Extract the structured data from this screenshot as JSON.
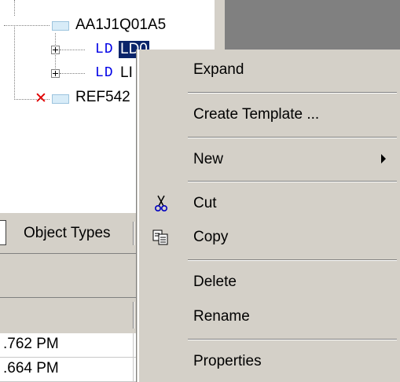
{
  "tree": {
    "root_label": "AA1J1Q01A5",
    "ld_tag": "LD",
    "ld1_name": "LD0",
    "ld2_name": "LI",
    "ref_label": "REF542"
  },
  "tabs": {
    "object_types": "Object Types"
  },
  "grid": {
    "rows": [
      ".762 PM",
      ".664 PM"
    ]
  },
  "context_menu": {
    "items": [
      {
        "label": "Expand"
      },
      {
        "label": "Create Template ..."
      },
      {
        "label": "New"
      },
      {
        "label": "Cut"
      },
      {
        "label": "Copy"
      },
      {
        "label": "Delete"
      },
      {
        "label": "Rename"
      },
      {
        "label": "Properties"
      }
    ]
  },
  "icons": {
    "cut": "scissors-icon",
    "copy": "copy-icon",
    "submenu": "submenu-arrow-icon"
  }
}
